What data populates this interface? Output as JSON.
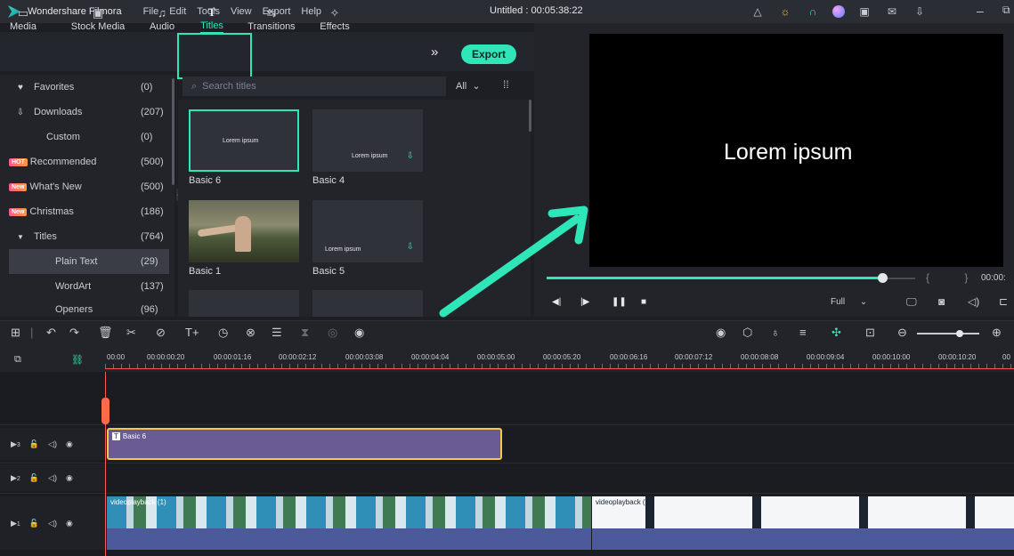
{
  "app": {
    "name": "Wondershare Filmora",
    "menu": [
      "File",
      "Edit",
      "Tools",
      "View",
      "Export",
      "Help"
    ],
    "doc_title": "Untitled : 00:05:38:22",
    "accent_color": "#2ee6b8"
  },
  "tabs": [
    {
      "label": "Media",
      "icon": "folder-icon"
    },
    {
      "label": "Stock Media",
      "icon": "stock-media-icon"
    },
    {
      "label": "Audio",
      "icon": "music-note-icon"
    },
    {
      "label": "Titles",
      "icon": "text-t-icon",
      "active": true
    },
    {
      "label": "Transitions",
      "icon": "transitions-icon"
    },
    {
      "label": "Effects",
      "icon": "effects-icon"
    }
  ],
  "toolbar": {
    "more": "»",
    "export_label": "Export"
  },
  "sidebar": {
    "items": [
      {
        "label": "Favorites",
        "count": "(0)",
        "icon": "heart-icon"
      },
      {
        "label": "Downloads",
        "count": "(207)",
        "icon": "download-icon"
      },
      {
        "label": "Custom",
        "count": "(0)"
      },
      {
        "label": "Recommended",
        "count": "(500)",
        "badge": "HOT"
      },
      {
        "label": "What's New",
        "count": "(500)",
        "badge": "New"
      },
      {
        "label": "Christmas",
        "count": "(186)",
        "badge": "New"
      },
      {
        "label": "Titles",
        "count": "(764)",
        "icon": "caret-down-icon"
      },
      {
        "label": "Plain Text",
        "count": "(29)",
        "active": true
      },
      {
        "label": "WordArt",
        "count": "(137)"
      },
      {
        "label": "Openers",
        "count": "(96)"
      }
    ]
  },
  "search": {
    "placeholder": "Search titles",
    "filter": "All"
  },
  "thumbnails": [
    {
      "name": "Basic 6",
      "text": "Lorem ipsum",
      "selected": true
    },
    {
      "name": "Basic 4",
      "text": "Lorem ipsum",
      "download": true
    },
    {
      "name": "Basic 1",
      "photo": true
    },
    {
      "name": "Basic 5",
      "text": "Lorem ipsum",
      "download": true
    }
  ],
  "preview": {
    "text": "Lorem ipsum",
    "time": "00:00:",
    "quality": "Full",
    "brackets": "{ }",
    "progress": 0.98
  },
  "ruler": {
    "labels": [
      "00:00",
      "00:00:00:20",
      "00:00:01:16",
      "00:00:02:12",
      "00:00:03:08",
      "00:00:04:04",
      "00:00:05:00",
      "00:00:05:20",
      "00:00:06:16",
      "00:00:07:12",
      "00:00:08:08",
      "00:00:09:04",
      "00:00:10:00",
      "00:00:10:20",
      "00"
    ]
  },
  "tracks": [
    {
      "number": "3",
      "clip": "Basic 6",
      "type": "title"
    },
    {
      "number": "2",
      "clip": ""
    },
    {
      "number": "1",
      "clips": [
        "videoplayback (1)",
        "videoplayback (1)"
      ],
      "type": "video"
    }
  ]
}
